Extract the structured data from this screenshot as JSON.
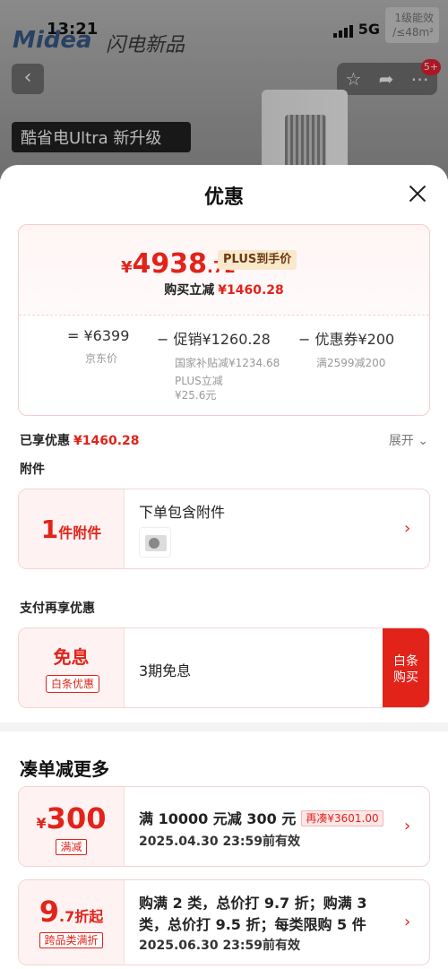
{
  "background": {
    "time": "13:21",
    "network": "5G",
    "brand": "Midea",
    "brand_sub": "闪电新品",
    "energy_label": "1级能效",
    "energy_sub": "/≤48m²",
    "cart_badge": "5+",
    "promo_tag": "酷省电Ultra 新升级"
  },
  "sheet": {
    "title": "优惠"
  },
  "price": {
    "yen": "¥",
    "integer": "4938",
    "decimal": ".72",
    "plus_tag": "PLUS到手价",
    "instant_label": "购买立减",
    "instant_value": "¥1460.28"
  },
  "breakdown": {
    "jd": {
      "main": "= ¥6399",
      "sub": "京东价"
    },
    "promo": {
      "main": "− 促销¥1260.28",
      "sub1": "国家补贴减¥1234.68",
      "sub2": "PLUS立减",
      "sub3": "¥25.6元"
    },
    "coupon": {
      "main": "− 优惠券¥200",
      "sub": "满2599减200"
    }
  },
  "enjoyed": {
    "label": "已享优惠",
    "value": "¥1460.28",
    "expand": "展开 ⌄"
  },
  "accessory": {
    "section": "附件",
    "count": "1",
    "unit": "件附件",
    "title": "下单包含附件"
  },
  "payment": {
    "section": "支付再享优惠",
    "main": "免息",
    "tag": "白条优惠",
    "title": "3期免息",
    "button_line1": "白条",
    "button_line2": "购买"
  },
  "more": {
    "title": "凑单减更多",
    "coupons": [
      {
        "yen": "¥",
        "big": "300",
        "small": "",
        "tag": "满减",
        "line1": "满 10000 元减 300 元",
        "gap": "再凑¥3601.00",
        "date": "2025.04.30 23:59前有效"
      },
      {
        "yen": "",
        "big": "9",
        "small": ".7折起",
        "tag": "跨品类满折",
        "line1": "购满 2 类，总价打 9.7 折；购满 3",
        "line2": "类，总价打 9.5 折；每类限购 5 件",
        "date": "2025.06.30 23:59前有效"
      }
    ]
  },
  "colors": {
    "accent": "#e2231a",
    "card_border": "#f3d3d5",
    "card_left_bg": "#fff2f2"
  }
}
